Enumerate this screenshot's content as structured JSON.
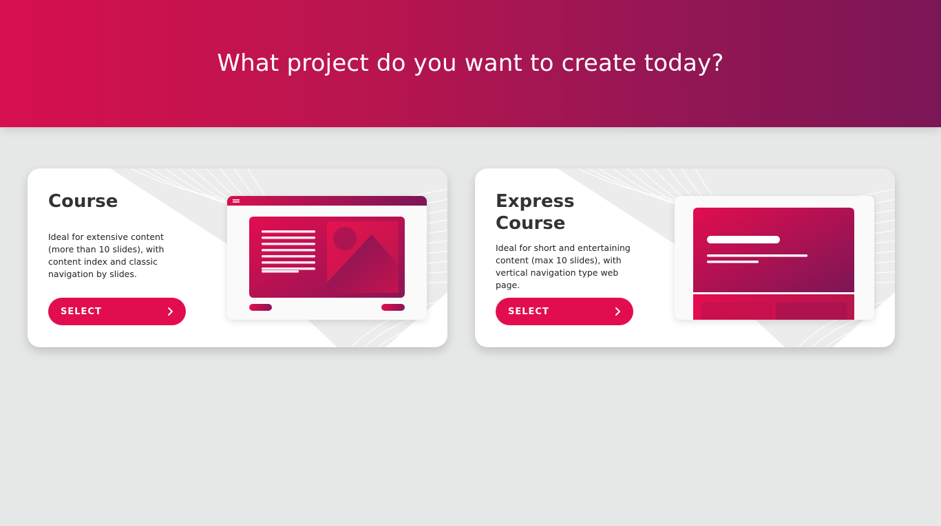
{
  "header": {
    "title": "What project do you want to create today?"
  },
  "cards": [
    {
      "title": "Course",
      "description": "Ideal for extensive content (more than 10 slides), with content index and classic navigation by slides.",
      "button_label": "SELECT"
    },
    {
      "title": "Express Course",
      "description": "Ideal for short and entertaining content (max 10 slides), with vertical navigation type web page.",
      "button_label": "SELECT"
    }
  ],
  "icons": {
    "button": "chevron-right-icon"
  },
  "colors": {
    "accent": "#e20d4f",
    "header_start": "#d6104e",
    "header_end": "#7b1656",
    "background": "#e6e7e7",
    "card": "#ffffff",
    "title_text": "#333333"
  }
}
